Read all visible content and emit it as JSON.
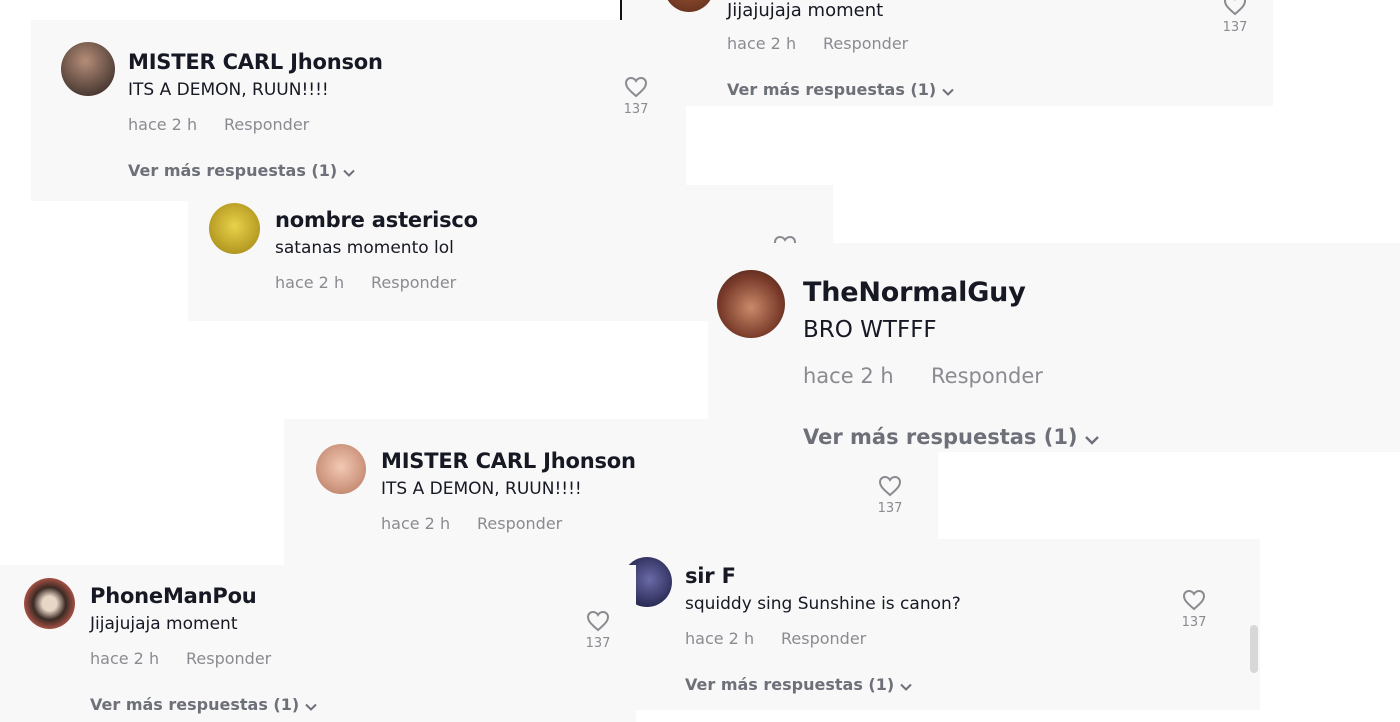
{
  "comments": [
    {
      "user": "MISTER CARL Jhonson",
      "text": "ITS A DEMON, RUUN!!!!",
      "time": "hace 2 h",
      "reply": "Responder",
      "more": "Ver más respuestas (1)",
      "likes": "137"
    },
    {
      "user": "nombre asterisco",
      "text": "satanas momento lol",
      "time": "hace 2 h",
      "reply": "Responder"
    },
    {
      "text": "Jijajujaja moment",
      "time": "hace 2 h",
      "reply": "Responder",
      "more": "Ver más respuestas (1)",
      "likes": "137"
    },
    {
      "user": "TheNormalGuy",
      "text": "BRO WTFFF",
      "time": "hace 2 h",
      "reply": "Responder",
      "more": "Ver más respuestas (1)"
    },
    {
      "user": "MISTER CARL Jhonson",
      "text": "ITS A DEMON, RUUN!!!!",
      "time": "hace 2 h",
      "reply": "Responder",
      "likes": "137"
    },
    {
      "user": "PhoneManPou",
      "text": "Jijajujaja moment",
      "time": "hace 2 h",
      "reply": "Responder",
      "more": "Ver más respuestas (1)",
      "likes": "137"
    },
    {
      "user": "sir F",
      "text": "squiddy sing Sunshine is canon?",
      "time": "hace 2 h",
      "reply": "Responder",
      "more": "Ver más respuestas (1)",
      "likes": "137"
    }
  ],
  "icons": {
    "like": "heart-outline-icon",
    "expand": "chevron-down-icon"
  },
  "colors": {
    "card_bg": "#f8f8f8",
    "primary_text": "#161823",
    "secondary_text": "#8a8b91",
    "more_text": "#6e7079"
  }
}
